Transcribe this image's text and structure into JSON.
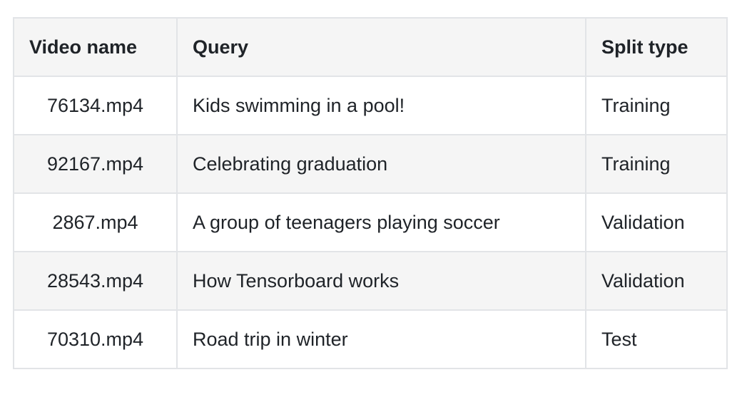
{
  "table": {
    "headers": {
      "video_name": "Video name",
      "query": "Query",
      "split_type": "Split type"
    },
    "rows": [
      {
        "video_name": "76134.mp4",
        "query": "Kids swimming in a pool!",
        "split_type": "Training"
      },
      {
        "video_name": "92167.mp4",
        "query": "Celebrating graduation",
        "split_type": "Training"
      },
      {
        "video_name": "2867.mp4",
        "query": "A group of teenagers playing soccer",
        "split_type": "Validation"
      },
      {
        "video_name": "28543.mp4",
        "query": "How Tensorboard works",
        "split_type": "Validation"
      },
      {
        "video_name": "70310.mp4",
        "query": "Road trip in winter",
        "split_type": "Test"
      }
    ]
  },
  "colors": {
    "header_background": "#f5f5f5",
    "stripe_background": "#f5f5f5",
    "border": "#e2e4e7",
    "text": "#1f2328"
  }
}
